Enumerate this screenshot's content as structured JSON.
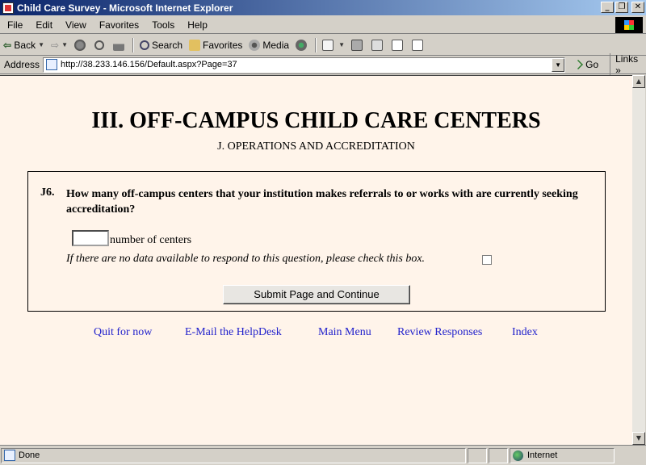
{
  "window": {
    "title": "Child Care Survey - Microsoft Internet Explorer"
  },
  "window_controls": {
    "minimize": "_",
    "maximize": "❐",
    "close": "✕"
  },
  "menu": [
    "File",
    "Edit",
    "View",
    "Favorites",
    "Tools",
    "Help"
  ],
  "toolbar": {
    "back": "Back",
    "search": "Search",
    "favorites": "Favorites",
    "media": "Media"
  },
  "address": {
    "label": "Address",
    "url": "http://38.233.146.156/Default.aspx?Page=37",
    "go": "Go",
    "links": "Links"
  },
  "page": {
    "heading": "III. OFF-CAMPUS CHILD CARE CENTERS",
    "subheading": "J. OPERATIONS AND ACCREDITATION",
    "question_number": "J6.",
    "question_text": "How many off-campus centers that your institution makes referrals to or works with are currently seeking accreditation?",
    "input_value": "",
    "input_label": "number of centers",
    "no_data_text": "If there are no data available to respond to this question, please check this box.",
    "no_data_checked": false,
    "submit_label": "Submit Page and Continue",
    "link_color": "#2222cc",
    "background_color": "#fff4ea"
  },
  "nav_links": [
    "Quit for now",
    "E-Mail the HelpDesk",
    "Main Menu",
    "Review Responses",
    "Index"
  ],
  "status": {
    "text": "Done",
    "zone": "Internet"
  }
}
